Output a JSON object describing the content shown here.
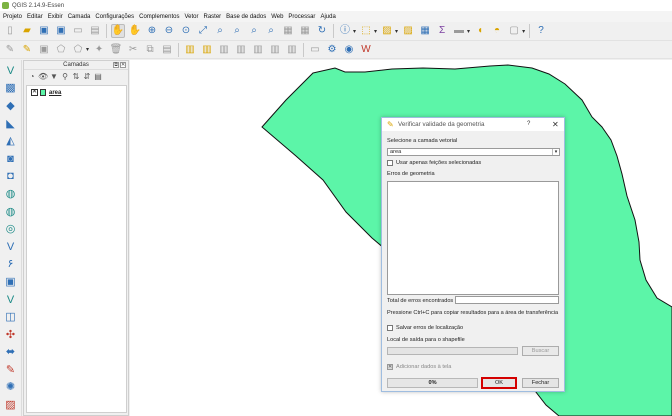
{
  "window": {
    "title": "QGIS 2.14.9-Essen"
  },
  "menubar": [
    "Projeto",
    "Editar",
    "Exibir",
    "Camada",
    "Configurações",
    "Complementos",
    "Vetor",
    "Raster",
    "Base de dados",
    "Web",
    "Processar",
    "Ajuda"
  ],
  "layers_panel": {
    "title": "Camadas",
    "layers": [
      {
        "name": "area",
        "checked_mark": "✕",
        "color": "#5cf5a8"
      }
    ]
  },
  "map": {
    "polygon_fill": "#5cf5a8",
    "polygon_stroke": "#111111"
  },
  "dialog": {
    "title": "Verificar validade da geometria",
    "help": "?",
    "close": "✕",
    "layer_label": "Selecione a camada vetorial",
    "layer_value": "area",
    "selected_only_label": "Usar apenas feições selecionadas",
    "errors_label": "Erros de geometria",
    "total_errors_label": "Total de erros encontrados",
    "total_errors_value": "",
    "hint": "Pressione Ctrl+C para copiar resultados para a área de transferência",
    "save_errors_label": "Salvar erros de localização",
    "output_label": "Local de saída para o shapefile",
    "output_value": "",
    "browse_button": "Buscar",
    "add_to_canvas_label": "Adicionar dados à tela",
    "add_to_canvas_mark": "✕",
    "progress": "0%",
    "ok_button": "OK",
    "close_button": "Fechar"
  },
  "icons": {
    "main_toolbar": [
      "new-project-icon",
      "open-project-icon",
      "save-project-icon",
      "save-as-icon",
      "print-composer-icon",
      "composer-manager-icon",
      "pan-map-icon",
      "pan-to-selection-icon",
      "zoom-in-icon",
      "zoom-out-icon",
      "zoom-native-icon",
      "zoom-full-icon",
      "zoom-to-selection-icon",
      "zoom-to-layer-icon",
      "zoom-last-icon",
      "zoom-next-icon",
      "new-bookmark-icon",
      "show-bookmarks-icon",
      "refresh-icon",
      "identify-icon",
      "select-features-icon",
      "deselect-icon",
      "field-calculator-icon",
      "attribute-table-icon",
      "statistics-icon",
      "measure-icon",
      "map-tips-icon",
      "text-annotation-icon",
      "help-icon"
    ],
    "edit_toolbar": [
      "current-edits-icon",
      "toggle-editing-icon",
      "save-edits-icon",
      "add-feature-icon",
      "move-feature-icon",
      "node-tool-icon",
      "delete-selected-icon",
      "cut-features-icon",
      "copy-features-icon",
      "paste-features-icon",
      "label-toolbar-icon",
      "python-console-icon",
      "web-icon",
      "wfs-icon"
    ],
    "layer_toolbar": [
      "add-vector-icon",
      "add-raster-icon",
      "add-postgis-icon",
      "add-spatialite-icon",
      "add-mssql-icon",
      "add-oracle-icon",
      "add-db2-icon",
      "add-wms-icon",
      "add-wcs-icon",
      "add-wfs-icon",
      "add-delimited-text-icon",
      "add-virtual-layer-icon",
      "new-shapefile-icon",
      "new-spatialite-icon",
      "new-gpx-icon",
      "create-temp-layer-icon",
      "georeferencer-icon",
      "offline-editing-icon",
      "heatmap-icon",
      "georeferencer-2-icon"
    ]
  }
}
